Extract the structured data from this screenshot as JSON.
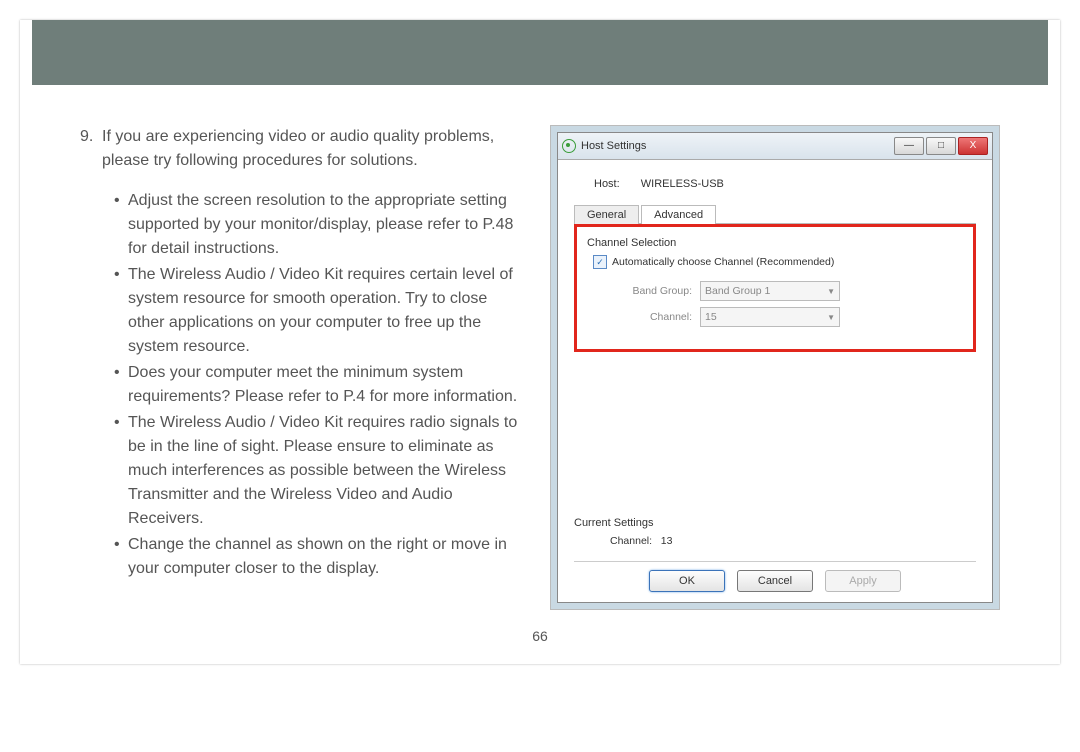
{
  "step": {
    "number": "9.",
    "intro": "If you are experiencing video or audio quality problems, please try following procedures for solutions.",
    "bullets": [
      "Adjust the screen resolution to the appropriate setting supported by your monitor/display, please refer to P.48 for detail instructions.",
      "The Wireless Audio / Video Kit requires certain level of system resource for smooth operation.  Try to close other applications on your computer to free up the system resource.",
      "Does your computer meet the minimum system requirements?  Please refer to P.4 for more information.",
      "The Wireless Audio / Video Kit requires radio signals to be in the line of sight.  Please ensure to eliminate as much interferences as possible between the Wireless Transmitter and the Wireless Video and Audio Receivers.",
      "Change the channel as shown on the right or move in your computer closer to the display."
    ]
  },
  "page_number": "66",
  "dialog": {
    "title": "Host Settings",
    "min_glyph": "—",
    "max_glyph": "□",
    "close_glyph": "X",
    "host_label": "Host:",
    "host_value": "WIRELESS-USB",
    "tabs": {
      "general": "General",
      "advanced": "Advanced"
    },
    "channel_selection_title": "Channel Selection",
    "auto_checkbox_mark": "✓",
    "auto_checkbox_label": "Automatically choose Channel (Recommended)",
    "band_group_label": "Band Group:",
    "band_group_value": "Band Group 1",
    "channel_label": "Channel:",
    "channel_value": "15",
    "current_settings_title": "Current Settings",
    "current_channel_label": "Channel:",
    "current_channel_value": "13",
    "buttons": {
      "ok": "OK",
      "cancel": "Cancel",
      "apply": "Apply"
    }
  }
}
